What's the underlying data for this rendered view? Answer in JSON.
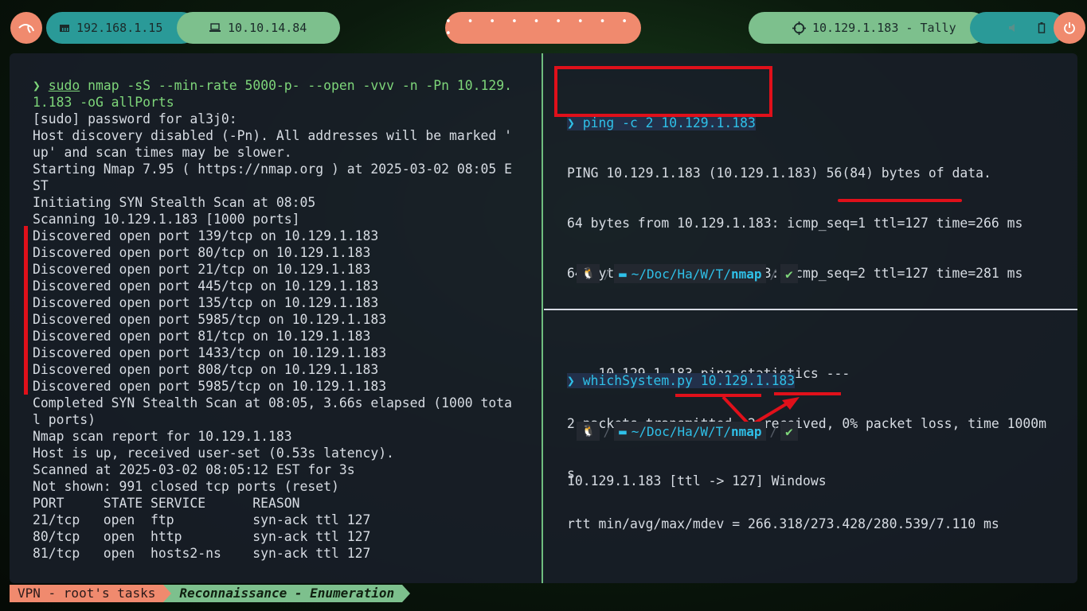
{
  "topbar": {
    "local_ip": "192.168.1.15",
    "vpn_ip": "10.10.14.84",
    "target": "10.129.1.183 - Tally",
    "workspace_dots": "• • • • • • • • • •"
  },
  "left_pane": {
    "lines": [
      {
        "k": "cmd",
        "prompt": "❯ ",
        "sudo": "sudo",
        "cmd": " nmap -sS --min-rate 5000-p- --open -vvv -n -Pn 10.129."
      },
      {
        "k": "plain",
        "text": "1.183 -oG allPorts"
      },
      {
        "k": "plain",
        "text": "[sudo] password for al3j0:"
      },
      {
        "k": "plain",
        "text": "Host discovery disabled (-Pn). All addresses will be marked '"
      },
      {
        "k": "plain",
        "text": "up' and scan times may be slower."
      },
      {
        "k": "plain",
        "text": "Starting Nmap 7.95 ( https://nmap.org ) at 2025-03-02 08:05 E"
      },
      {
        "k": "plain",
        "text": "ST"
      },
      {
        "k": "plain",
        "text": "Initiating SYN Stealth Scan at 08:05"
      },
      {
        "k": "plain",
        "text": "Scanning 10.129.1.183 [1000 ports]"
      },
      {
        "k": "plain",
        "text": "Discovered open port 139/tcp on 10.129.1.183"
      },
      {
        "k": "plain",
        "text": "Discovered open port 80/tcp on 10.129.1.183"
      },
      {
        "k": "plain",
        "text": "Discovered open port 21/tcp on 10.129.1.183"
      },
      {
        "k": "plain",
        "text": "Discovered open port 445/tcp on 10.129.1.183"
      },
      {
        "k": "plain",
        "text": "Discovered open port 135/tcp on 10.129.1.183"
      },
      {
        "k": "plain",
        "text": "Discovered open port 5985/tcp on 10.129.1.183"
      },
      {
        "k": "plain",
        "text": "Discovered open port 81/tcp on 10.129.1.183"
      },
      {
        "k": "plain",
        "text": "Discovered open port 1433/tcp on 10.129.1.183"
      },
      {
        "k": "plain",
        "text": "Discovered open port 808/tcp on 10.129.1.183"
      },
      {
        "k": "plain",
        "text": "Discovered open port 5985/tcp on 10.129.1.183"
      },
      {
        "k": "plain",
        "text": "Completed SYN Stealth Scan at 08:05, 3.66s elapsed (1000 tota"
      },
      {
        "k": "plain",
        "text": "l ports)"
      },
      {
        "k": "plain",
        "text": "Nmap scan report for 10.129.1.183"
      },
      {
        "k": "plain",
        "text": "Host is up, received user-set (0.53s latency)."
      },
      {
        "k": "plain",
        "text": "Scanned at 2025-03-02 08:05:12 EST for 3s"
      },
      {
        "k": "plain",
        "text": "Not shown: 991 closed tcp ports (reset)"
      },
      {
        "k": "plain",
        "text": "PORT     STATE SERVICE      REASON"
      },
      {
        "k": "plain",
        "text": "21/tcp   open  ftp          syn-ack ttl 127"
      },
      {
        "k": "plain",
        "text": "80/tcp   open  http         syn-ack ttl 127"
      },
      {
        "k": "plain",
        "text": "81/tcp   open  hosts2-ns    syn-ack ttl 127"
      }
    ]
  },
  "right_top": {
    "cmd": "❯ ping -c 2 10.129.1.183",
    "output": [
      "PING 10.129.1.183 (10.129.1.183) 56(84) bytes of data.",
      "64 bytes from 10.129.1.183: icmp_seq=1 ttl=127 time=266 ms",
      "64 bytes from 10.129.1.183: icmp_seq=2 ttl=127 time=281 ms",
      "",
      "--- 10.129.1.183 ping statistics ---",
      "2 packets transmitted, 2 received, 0% packet loss, time 1000m",
      "s",
      "rtt min/avg/max/mdev = 266.318/273.428/280.539/7.110 ms"
    ]
  },
  "right_bottom": {
    "cmd": "❯ whichSystem.py 10.129.1.183",
    "output": "10.129.1.183 [ttl -> 127] Windows"
  },
  "prompt": {
    "os_icon": "🐧",
    "path": "~/Doc/Ha/W/T/",
    "dir": "nmap",
    "ok": "✔"
  },
  "statusbar": {
    "session": "VPN - root's tasks",
    "window": "Reconnaissance - Enumeration"
  },
  "colors": {
    "accent_salmon": "#f08a6e",
    "accent_green": "#7dc08d",
    "accent_teal": "#2a9a98",
    "highlight_red": "#e0101a",
    "command_cyan": "#2fc0e8"
  }
}
